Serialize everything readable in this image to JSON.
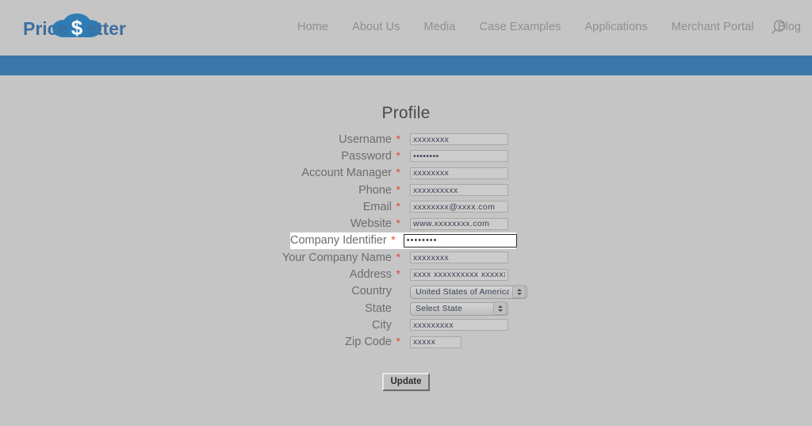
{
  "header": {
    "logo": {
      "text_part1": "Price",
      "text_part2": "etter",
      "dollar_glyph": "$",
      "icon_name": "cloud-dollar-logo",
      "brand_color": "#2e7cb4",
      "text_color": "#3b6fa0"
    },
    "nav_items": [
      {
        "label": "Home"
      },
      {
        "label": "About Us"
      },
      {
        "label": "Media"
      },
      {
        "label": "Case Examples"
      },
      {
        "label": "Applications"
      },
      {
        "label": "Merchant Portal"
      },
      {
        "label": "Blog"
      }
    ],
    "search": {
      "icon_name": "search-icon",
      "label": "Search"
    },
    "accent_bar_color": "#3c77aa"
  },
  "page": {
    "title": "Profile",
    "background_color": "#c5c5c5"
  },
  "form": {
    "required_marker": "*",
    "fields": [
      {
        "label": "Username",
        "required": true,
        "type": "text",
        "value": "xxxxxxxx",
        "placeholder": "",
        "name": "username-field",
        "width": "std",
        "highlighted": false
      },
      {
        "label": "Password",
        "required": true,
        "type": "password",
        "value": "••••••••",
        "placeholder": "",
        "name": "password-field",
        "width": "std",
        "highlighted": false
      },
      {
        "label": "Account Manager",
        "required": true,
        "type": "text",
        "value": "xxxxxxxx",
        "placeholder": "",
        "name": "account-manager-field",
        "width": "std",
        "highlighted": false
      },
      {
        "label": "Phone",
        "required": true,
        "type": "text",
        "value": "xxxxxxxxxx",
        "placeholder": "",
        "name": "phone-field",
        "width": "std",
        "highlighted": false
      },
      {
        "label": "Email",
        "required": true,
        "type": "text",
        "value": "xxxxxxxx@xxxx.com",
        "placeholder": "",
        "name": "email-field",
        "width": "std",
        "highlighted": false
      },
      {
        "label": "Website",
        "required": true,
        "type": "text",
        "value": "www.xxxxxxxx.com",
        "placeholder": "",
        "name": "website-field",
        "width": "std",
        "highlighted": false
      },
      {
        "label": "Company Identifier",
        "required": true,
        "type": "password",
        "value": "••••••••",
        "placeholder": "",
        "name": "company-identifier-field",
        "width": "focused",
        "highlighted": true
      },
      {
        "label": "Your Company Name",
        "required": true,
        "type": "text",
        "value": "xxxxxxxx",
        "placeholder": "",
        "name": "company-name-field",
        "width": "std",
        "highlighted": false
      },
      {
        "label": "Address",
        "required": true,
        "type": "text",
        "value": "xxxx xxxxxxxxxx xxxxxx",
        "placeholder": "",
        "name": "address-field",
        "width": "std",
        "highlighted": false
      },
      {
        "label": "Country",
        "required": false,
        "type": "select",
        "value": "United States of America",
        "options": [
          "United States of America"
        ],
        "name": "country-select",
        "width": "country",
        "highlighted": false
      },
      {
        "label": "State",
        "required": false,
        "type": "select",
        "value": "Select State",
        "options": [
          "Select State"
        ],
        "name": "state-select",
        "width": "state",
        "highlighted": false
      },
      {
        "label": "City",
        "required": false,
        "type": "text",
        "value": "xxxxxxxxx",
        "placeholder": "",
        "name": "city-field",
        "width": "std",
        "highlighted": false
      },
      {
        "label": "Zip Code",
        "required": true,
        "type": "text",
        "value": "xxxxx",
        "placeholder": "",
        "name": "zip-code-field",
        "width": "zip",
        "highlighted": false
      }
    ],
    "submit": {
      "label": "Update",
      "name": "update-button"
    }
  }
}
